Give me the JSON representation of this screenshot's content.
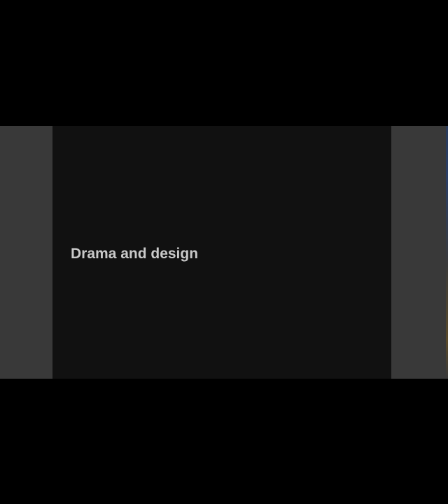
{
  "slide": {
    "title": "Drama and design"
  },
  "colors": {
    "letterbox": "#000000",
    "slide_background": "#111111",
    "side_panels": "#393939",
    "title_text": "#c9c9c9"
  }
}
